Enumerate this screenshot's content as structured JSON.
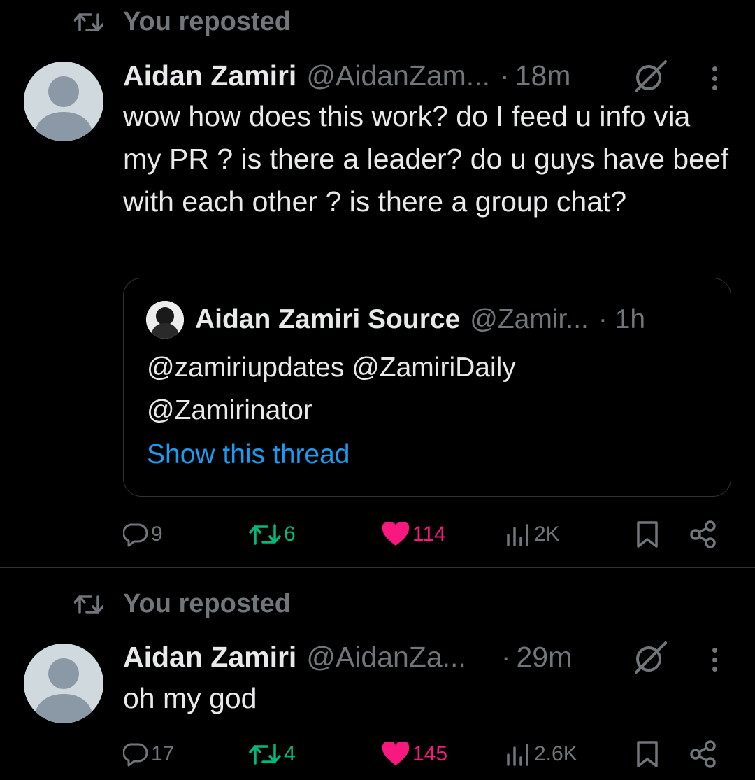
{
  "colors": {
    "background": "#000000",
    "text_primary": "#e7e9ea",
    "text_secondary": "#71767b",
    "link": "#1d9bf0",
    "retweet": "#00ba7c",
    "like": "#f91880",
    "border": "#2f3336"
  },
  "posts": [
    {
      "repost_label": "You reposted",
      "author_name": "Aidan Zamiri",
      "handle": "@AidanZam...",
      "separator": "·",
      "time": "18m",
      "text": "wow how does this work? do I feed u info via my PR ? is there a leader? do u guys have beef with each other ? is there a group chat?",
      "quote": {
        "author_name": "Aidan Zamiri Source",
        "handle": "@Zamir...",
        "time": "· 1h",
        "line1": "@zamiriupdates @ZamiriDaily",
        "line2": "@Zamirinator",
        "show_thread": "Show this thread"
      },
      "actions": {
        "replies": "9",
        "reposts": "6",
        "likes": "114",
        "views": "2K"
      }
    },
    {
      "repost_label": "You reposted",
      "author_name": "Aidan Zamiri",
      "handle": "@AidanZa...",
      "separator": "·",
      "time": "29m",
      "text": "oh my god",
      "actions": {
        "replies": "17",
        "reposts": "4",
        "likes": "145",
        "views": "2.6K"
      }
    }
  ]
}
